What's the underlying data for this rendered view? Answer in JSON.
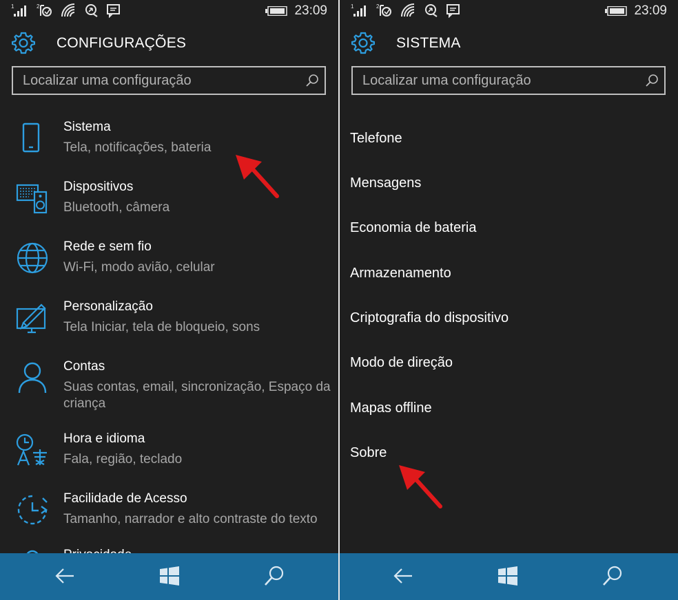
{
  "left": {
    "status": {
      "time": "23:09"
    },
    "header": {
      "title": "CONFIGURAÇÕES"
    },
    "search": {
      "placeholder": "Localizar uma configuração"
    },
    "categories": [
      {
        "name": "Sistema",
        "desc": "Tela, notificações, bateria",
        "icon": "phone-icon"
      },
      {
        "name": "Dispositivos",
        "desc": "Bluetooth, câmera",
        "icon": "devices-icon"
      },
      {
        "name": "Rede e sem fio",
        "desc": "Wi-Fi, modo avião, celular",
        "icon": "globe-icon"
      },
      {
        "name": "Personalização",
        "desc": "Tela Iniciar, tela de bloqueio, sons",
        "icon": "personalization-icon"
      },
      {
        "name": "Contas",
        "desc": "Suas contas, email, sincronização, Espaço da",
        "desc2": "criança",
        "icon": "person-icon"
      },
      {
        "name": "Hora e idioma",
        "desc": "Fala, região, teclado",
        "icon": "time-language-icon"
      },
      {
        "name": "Facilidade de Acesso",
        "desc": "Tamanho, narrador e alto contraste do texto",
        "icon": "ease-of-access-icon"
      },
      {
        "name": "Privacidade",
        "icon": "lock-icon"
      }
    ]
  },
  "right": {
    "status": {
      "time": "23:09"
    },
    "header": {
      "title": "SISTEMA"
    },
    "search": {
      "placeholder": "Localizar uma configuração"
    },
    "items": [
      "Telefone",
      "Mensagens",
      "Economia de bateria",
      "Armazenamento",
      "Criptografia do dispositivo",
      "Modo de direção",
      "Mapas offline",
      "Sobre"
    ]
  },
  "navbar": {
    "icons": [
      "back-arrow-icon",
      "windows-start-icon",
      "search-icon"
    ]
  },
  "colors": {
    "background": "#1f1f1f",
    "accent": "#2d9ee0",
    "navbar": "#1a6a9a",
    "arrow": "#e0191b"
  }
}
